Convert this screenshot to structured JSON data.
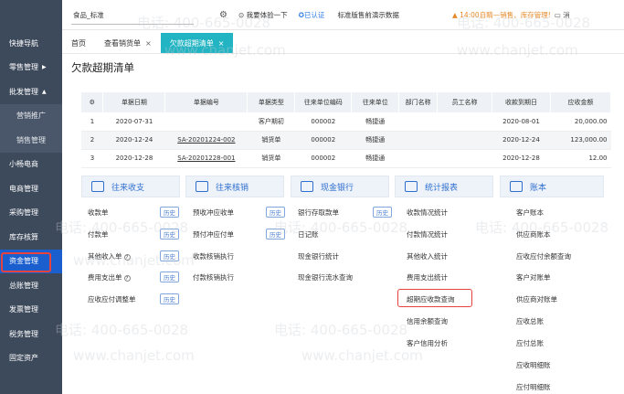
{
  "sidebar": {
    "items": [
      {
        "label": "快捷导航"
      },
      {
        "label": "零售管理",
        "caret": "▶"
      },
      {
        "label": "批发管理",
        "caret": "▲"
      },
      {
        "label": "营销推广"
      },
      {
        "label": "销售管理"
      },
      {
        "label": "小畅电商"
      },
      {
        "label": "电商管理"
      },
      {
        "label": "采购管理"
      },
      {
        "label": "库存核算"
      },
      {
        "label": "资金管理"
      },
      {
        "label": "总账管理"
      },
      {
        "label": "发票管理"
      },
      {
        "label": "税务管理"
      },
      {
        "label": "固定资产"
      }
    ]
  },
  "topbar": {
    "shop": "食品_标准",
    "trial": "我要体验一下",
    "cert": "已认证",
    "standard": "标准版售前演示数据",
    "warn": "14:00自睛—销售、库存管理!",
    "msg": "消"
  },
  "tabs": [
    {
      "label": "首页"
    },
    {
      "label": "查看销货单",
      "close": "×"
    },
    {
      "label": "欠款超期清单",
      "close": "×"
    }
  ],
  "page_title": "欠款超期清单",
  "table": {
    "headers": [
      "",
      "单据日期",
      "单据编号",
      "单据类型",
      "往来单位编码",
      "往来单位",
      "部门名称",
      "员工名称",
      "收款到期日",
      "应收金额"
    ],
    "rows": [
      [
        "1",
        "2020-07-31",
        "",
        "客户期初",
        "000002",
        "畅捷通",
        "",
        "",
        "2020-08-01",
        "20,000.00"
      ],
      [
        "2",
        "2020-12-24",
        "SA-20201224-002",
        "销货单",
        "000002",
        "畅捷通",
        "",
        "",
        "2020-12-24",
        "123,000.00"
      ],
      [
        "3",
        "2020-12-28",
        "SA-20201228-001",
        "销货单",
        "000002",
        "畅捷通",
        "",
        "",
        "2020-12-28",
        "12.00"
      ]
    ]
  },
  "sections": [
    {
      "title": "往来收支"
    },
    {
      "title": "往来核销"
    },
    {
      "title": "现金银行"
    },
    {
      "title": "统计报表"
    },
    {
      "title": "账本"
    }
  ],
  "col1": [
    "收款单",
    "付款单",
    "其他收入单",
    "费用支出单",
    "应收应付调整单"
  ],
  "col2": [
    "预收冲应收单",
    "预付冲应付单",
    "收款核销执行",
    "付款核销执行"
  ],
  "col3": [
    "银行存取款单",
    "日记账",
    "现金银行统计",
    "现金银行流水查询"
  ],
  "col4": [
    "收款情况统计",
    "付款情况统计",
    "其他收入统计",
    "费用支出统计",
    "超期应收款查询",
    "信用余额查询",
    "客户信用分析"
  ],
  "col5": [
    "客户账本",
    "供应商账本",
    "应收应付余额查询",
    "客户对账单",
    "供应商对账单",
    "应收总账",
    "应付总账",
    "应收明细账",
    "应付明细账"
  ],
  "hist_label": "历史",
  "help_mark": "?",
  "watermark": {
    "phone": "电话: 400-665-0028",
    "site": "www.chanjet.com"
  }
}
